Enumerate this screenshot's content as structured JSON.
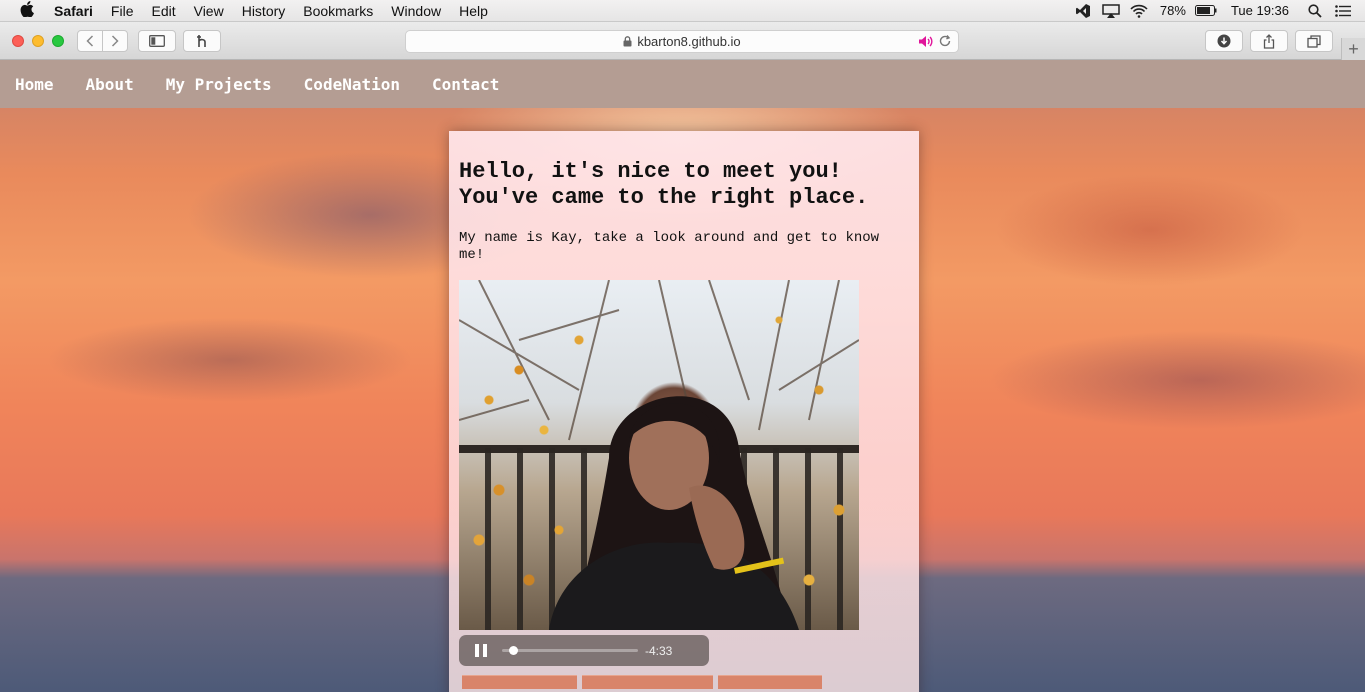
{
  "menubar": {
    "apple_icon": "apple-icon",
    "app": "Safari",
    "items": [
      "File",
      "Edit",
      "View",
      "History",
      "Bookmarks",
      "Window",
      "Help"
    ],
    "battery": "78%",
    "clock": "Tue 19:36"
  },
  "toolbar": {
    "url": "kbarton8.github.io"
  },
  "nav": {
    "items": [
      "Home",
      "About",
      "My Projects",
      "CodeNation",
      "Contact"
    ]
  },
  "card": {
    "heading_line1": "Hello, it's nice to meet you!",
    "heading_line2": "You've came to the right place.",
    "intro": "My name is Kay, take a look around and get to know me!"
  },
  "player": {
    "time_remaining": "-4:33",
    "progress": 0.05
  }
}
